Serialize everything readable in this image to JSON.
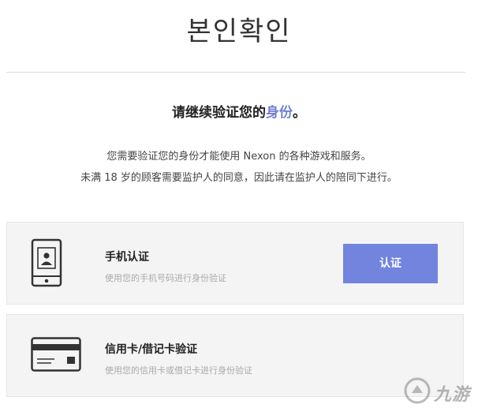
{
  "header": {
    "title": "본인확인"
  },
  "main": {
    "heading_prefix": "请继续验证您的",
    "heading_accent": "身份",
    "heading_suffix": "。",
    "description_line1": "您需要验证您的身份才能使用 Nexon 的各种游戏和服务。",
    "description_line2": "未满 18 岁的顾客需要监护人的同意，因此请在监护人的陪同下进行。"
  },
  "options": {
    "phone": {
      "icon": "phone-icon",
      "title": "手机认证",
      "subtitle": "使用您的手机号码进行身份验证",
      "button_label": "认证"
    },
    "credit_card": {
      "icon": "credit-card-icon",
      "title": "信用卡/借记卡验证",
      "subtitle": "使用您的信用卡或借记卡进行身份验证"
    }
  },
  "watermark": {
    "text": "九游"
  },
  "colors": {
    "accent": "#6f7fd6",
    "button": "#7284de",
    "card_bg": "#f4f4f4"
  }
}
